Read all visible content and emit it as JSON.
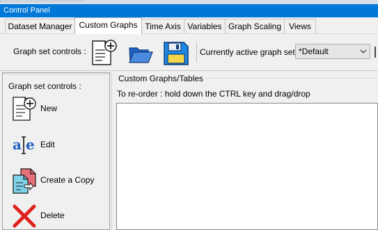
{
  "window": {
    "title": "Control Panel"
  },
  "tabs": [
    {
      "label": "Dataset Manager",
      "active": false
    },
    {
      "label": "Custom Graphs",
      "active": true
    },
    {
      "label": "Time Axis",
      "active": false
    },
    {
      "label": "Variables",
      "active": false
    },
    {
      "label": "Graph Scaling",
      "active": false
    },
    {
      "label": "Views",
      "active": false
    }
  ],
  "toolbar": {
    "label": "Graph set controls :",
    "icons": [
      "new-document-icon",
      "open-folder-icon",
      "save-disk-icon"
    ],
    "active_graph_set_label": "Currently active graph set",
    "active_graph_set_value": "*Default"
  },
  "left_panel": {
    "title": "Graph set controls :",
    "actions": [
      {
        "label": "New",
        "icon": "new-document-icon"
      },
      {
        "label": "Edit",
        "icon": "edit-text-icon"
      },
      {
        "label": "Create a Copy",
        "icon": "copy-documents-icon"
      },
      {
        "label": "Delete",
        "icon": "delete-x-icon"
      }
    ]
  },
  "main": {
    "group_title": "Custom Graphs/Tables",
    "hint": "To re-order : hold down the CTRL key and drag/drop"
  },
  "colors": {
    "titlebar": "#0078d7",
    "accent_blue": "#1f5fbf",
    "folder_blue": "#1e64c8",
    "save_blue": "#1e88e5",
    "delete_red": "#e0211b",
    "copy_pink": "#e8707a"
  }
}
